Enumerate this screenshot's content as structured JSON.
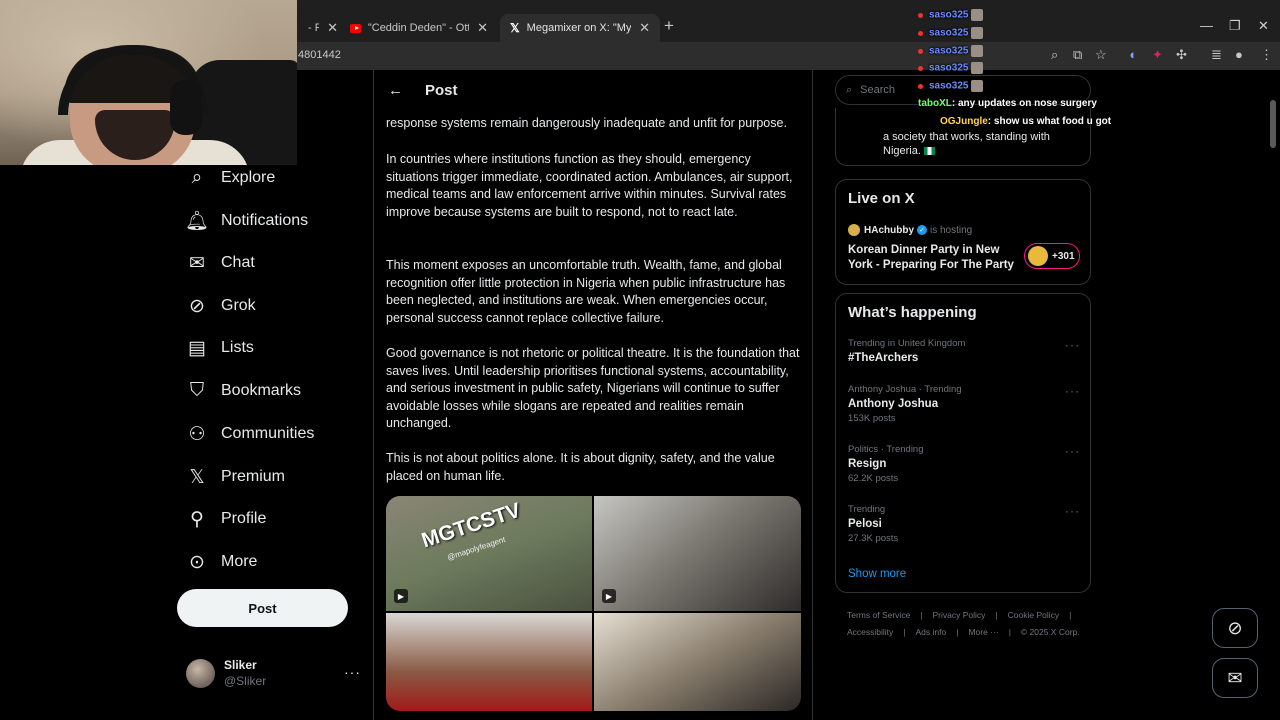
{
  "browser": {
    "tabs": [
      {
        "title": "- FA",
        "active": false
      },
      {
        "title": "\"Ceddin Deden\" - Ottoman/Tur",
        "active": false
      },
      {
        "title": "Megamixer on X: \"My heartfel",
        "active": true
      }
    ],
    "url": "4801442",
    "icons": [
      "zoom-icon",
      "install-icon",
      "star-icon",
      "extension-icon",
      "menu-icon"
    ]
  },
  "chat": [
    {
      "user": "saso325",
      "msg": ""
    },
    {
      "user": "saso325",
      "msg": ""
    },
    {
      "user": "saso325",
      "msg": ""
    },
    {
      "user": "saso325",
      "msg": ""
    },
    {
      "user": "saso325",
      "msg": ""
    },
    {
      "user": "taboXL",
      "msg": ": any updates on nose surgery"
    },
    {
      "user": "OGJungle",
      "msg": ": show us what food u got"
    }
  ],
  "nav": {
    "items": [
      {
        "label": "Explore",
        "icon": "search-icon"
      },
      {
        "label": "Notifications",
        "icon": "bell-icon"
      },
      {
        "label": "Chat",
        "icon": "mail-icon"
      },
      {
        "label": "Grok",
        "icon": "grok-icon"
      },
      {
        "label": "Lists",
        "icon": "list-icon"
      },
      {
        "label": "Bookmarks",
        "icon": "bookmark-icon"
      },
      {
        "label": "Communities",
        "icon": "people-icon"
      },
      {
        "label": "Premium",
        "icon": "x-icon"
      },
      {
        "label": "Profile",
        "icon": "person-icon"
      },
      {
        "label": "More",
        "icon": "more-circle-icon"
      }
    ],
    "post_button": "Post",
    "account": {
      "name": "Sliker",
      "handle": "@Sliker"
    }
  },
  "main": {
    "header_title": "Post",
    "paragraphs": [
      "response systems remain dangerously inadequate and unfit for purpose.",
      "In countries where institutions function as they should, emergency situations trigger immediate, coordinated action. Ambulances, air support, medical teams and law enforcement arrive within minutes. Survival rates improve because systems are built to respond, not to react late.",
      "This moment exposes an uncomfortable truth. Wealth, fame, and global recognition offer little protection in Nigeria when public infrastructure has been neglected, and institutions are weak. When emergencies occur, personal success cannot replace collective failure.",
      "Good governance is not rhetoric or political theatre. It is the foundation that saves lives. Until leadership prioritises functional systems, accountability, and serious investment in public safety, Nigerians will continue to suffer avoidable losses while slogans are repeated and realities remain unchanged.",
      "This is not about politics alone. It is about dignity, safety, and the value placed on human life."
    ],
    "media_watermark": "MGTCSTV",
    "media_watermark_sub": "@mapolyfeagent"
  },
  "right": {
    "search_placeholder": "Search",
    "top_card_text": "a society that works, standing with Nigeria.",
    "live": {
      "title": "Live on X",
      "host": "HAchubby",
      "host_status": "is hosting",
      "space_title": "Korean Dinner Party in New York - Preparing For The Party",
      "listeners": "+301"
    },
    "happening": {
      "title": "What’s happening",
      "trends": [
        {
          "meta": "Trending in United Kingdom",
          "name": "#TheArchers",
          "posts": ""
        },
        {
          "meta": "Anthony Joshua · Trending",
          "name": "Anthony Joshua",
          "posts": "153K posts"
        },
        {
          "meta": "Politics · Trending",
          "name": "Resign",
          "posts": "62.2K posts"
        },
        {
          "meta": "Trending",
          "name": "Pelosi",
          "posts": "27.3K posts"
        }
      ],
      "show_more": "Show more"
    },
    "footer_line1": [
      "Terms of Service",
      "|",
      "Privacy Policy",
      "|",
      "Cookie Policy",
      "|"
    ],
    "footer_line2": [
      "Accessibility",
      "|",
      "Ads info",
      "|",
      "More ···",
      "|",
      "© 2025 X Corp."
    ]
  },
  "colors": {
    "accent": "#1d9bf0",
    "background": "#000000",
    "border": "#2f3336",
    "muted": "#71767b"
  }
}
